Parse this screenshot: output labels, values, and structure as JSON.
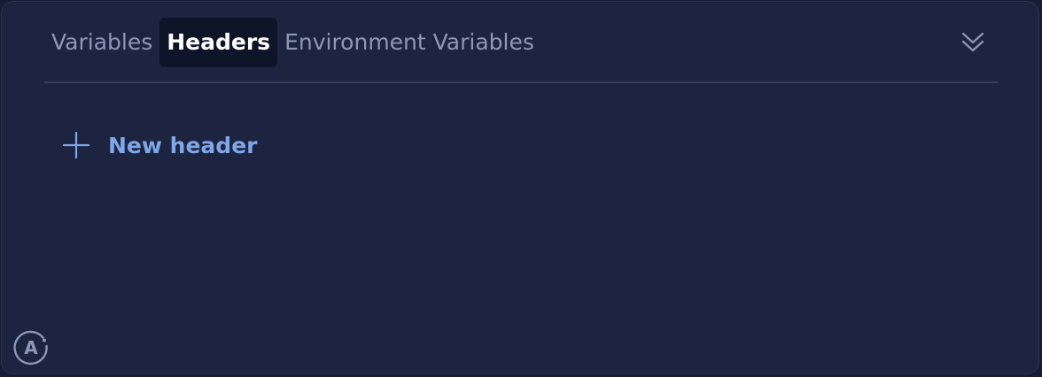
{
  "tabs": [
    {
      "label": "Variables",
      "active": false
    },
    {
      "label": "Headers",
      "active": true
    },
    {
      "label": "Environment Variables",
      "active": false
    }
  ],
  "actions": {
    "new_header_label": "New header"
  },
  "icons": {
    "collapse": "double-chevron-down-icon",
    "add": "plus-icon",
    "logo": "apollo-logo-icon"
  },
  "logo": {
    "letter": "A"
  },
  "colors": {
    "background": "#1d2440",
    "active_tab_bg": "#0f1529",
    "inactive_text": "#8d98b6",
    "accent": "#7fa6e6",
    "divider": "#353e5c"
  }
}
